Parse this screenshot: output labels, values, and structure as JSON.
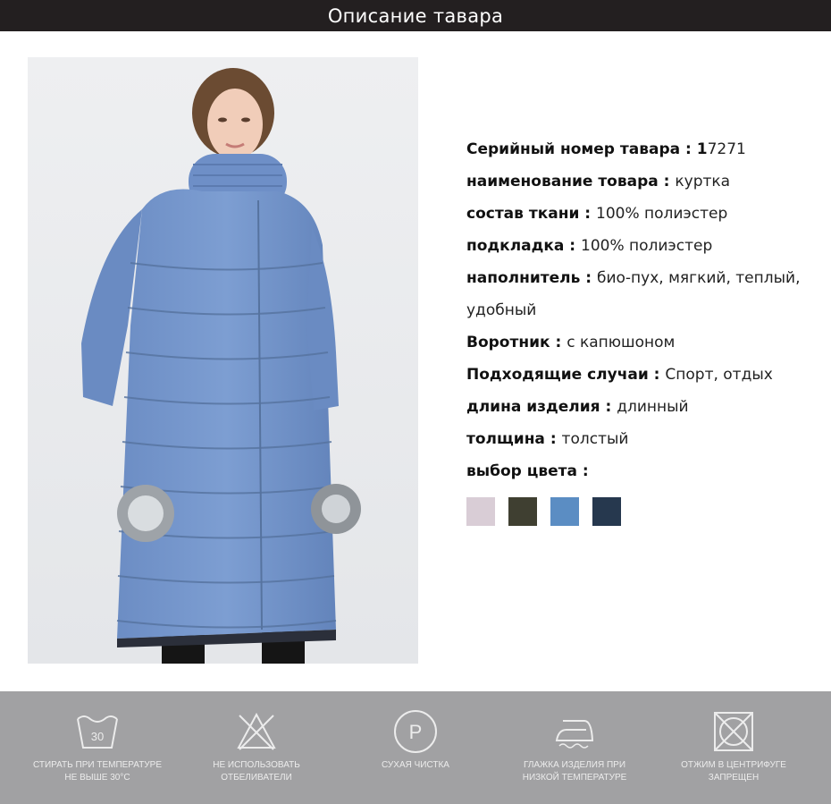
{
  "header": {
    "title": "Описание тавара"
  },
  "specs": [
    {
      "label": "Серийный номер тавара",
      "sep": " : ",
      "bold_value": "1",
      "value": "7271"
    },
    {
      "label": "наименование товара",
      "sep": " : ",
      "bold_value": "",
      "value": "куртка"
    },
    {
      "label": "состав ткани",
      "sep": " : ",
      "bold_value": "",
      "value": "100% полиэстер"
    },
    {
      "label": "подкладка",
      "sep": " : ",
      "bold_value": "",
      "value": "100% полиэстер"
    },
    {
      "label": "наполнитель",
      "sep": " : ",
      "bold_value": "",
      "value": "био-пух, мягкий, теплый, удобный"
    },
    {
      "label": "Воротник",
      "sep": " : ",
      "bold_value": "",
      "value": "с капюшоном"
    },
    {
      "label": "Подходящие случаи",
      "sep": " : ",
      "bold_value": "",
      "value": "Спорт, отдых"
    },
    {
      "label": "длина изделия",
      "sep": " : ",
      "bold_value": "",
      "value": "длинный"
    },
    {
      "label": "толщина",
      "sep": " : ",
      "bold_value": "",
      "value": "толстый"
    },
    {
      "label": "выбор цвета",
      "sep": " :",
      "bold_value": "",
      "value": ""
    }
  ],
  "colors": [
    "#d9cdd6",
    "#3f3f31",
    "#5b8dc3",
    "#26384e"
  ],
  "care": [
    {
      "icon": "wash-30-icon",
      "number": "30",
      "line1": "СТИРАТЬ ПРИ ТЕМПЕРАТУРЕ",
      "line2": "НЕ ВЫШЕ 30°С"
    },
    {
      "icon": "no-bleach-icon",
      "line1": "НЕ ИСПОЛЬЗОВАТЬ",
      "line2": "ОТБЕЛИВАТЕЛИ"
    },
    {
      "icon": "dry-clean-p-icon",
      "letter": "P",
      "line1": "СУХАЯ ЧИСТКА",
      "line2": ""
    },
    {
      "icon": "iron-low-icon",
      "line1": "ГЛАЖКА ИЗДЕЛИЯ ПРИ",
      "line2": "НИЗКОЙ ТЕМПЕРАТУРЕ"
    },
    {
      "icon": "no-tumble-dry-icon",
      "line1": "ОТЖИМ В ЦЕНТРИФУГЕ",
      "line2": "ЗАПРЕЩЕН"
    }
  ]
}
